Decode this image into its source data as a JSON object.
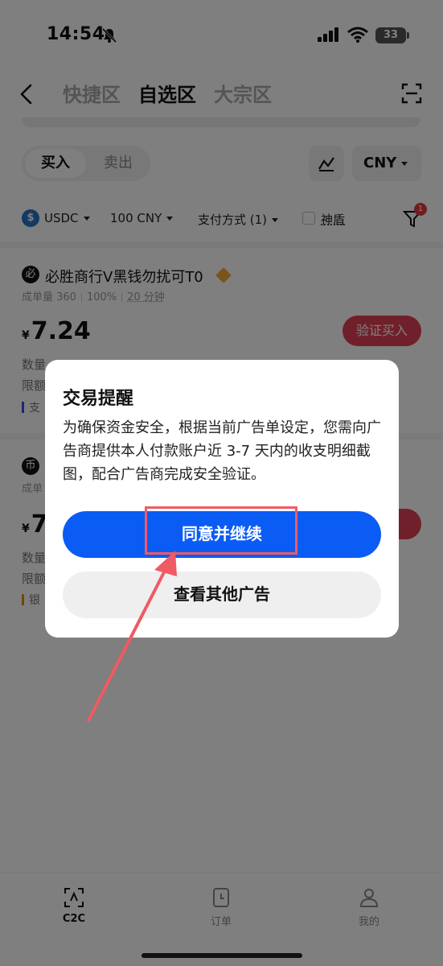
{
  "status_bar": {
    "time": "14:54",
    "battery": "33"
  },
  "header": {
    "tabs": [
      {
        "label": "快捷区",
        "active": false
      },
      {
        "label": "自选区",
        "active": true
      },
      {
        "label": "大宗区",
        "active": false
      }
    ]
  },
  "controls": {
    "buy_label": "买入",
    "sell_label": "卖出",
    "currency": "CNY"
  },
  "filters": {
    "coin": "USDC",
    "amount": "100 CNY",
    "payment": "支付方式 (1)",
    "shield": "神盾",
    "badge_count": "1"
  },
  "listings": [
    {
      "merchant": "必胜商行V黑钱勿扰可T0",
      "avatar": "必",
      "stats_volume": "成单量 360",
      "stats_rate": "100%",
      "stats_time": "20 分钟",
      "currency_symbol": "¥",
      "price": "7.24",
      "qty_label": "数量",
      "limit_label": "限额",
      "payment_label": "支",
      "button": "验证买入"
    },
    {
      "avatar": "币",
      "stats_volume": "成单",
      "currency_symbol": "¥",
      "price": "7",
      "qty_label": "数量",
      "limit_label": "限额",
      "payment_label": "银",
      "button": "入"
    }
  ],
  "dialog": {
    "title": "交易提醒",
    "body": "为确保资金安全，根据当前广告单设定，您需向广告商提供本人付款账户近 3-7 天内的收支明细截图，配合广告商完成安全验证。",
    "primary_button": "同意并继续",
    "secondary_button": "查看其他广告"
  },
  "bottom_nav": [
    {
      "label": "C2C",
      "icon": "c2c-icon",
      "active": true
    },
    {
      "label": "订单",
      "icon": "orders-icon",
      "active": false
    },
    {
      "label": "我的",
      "icon": "profile-icon",
      "active": false
    }
  ],
  "colors": {
    "primary": "#0a5cf5",
    "buy_button": "#e04055",
    "annotation": "#f05a64",
    "coin": "#2775ca"
  }
}
